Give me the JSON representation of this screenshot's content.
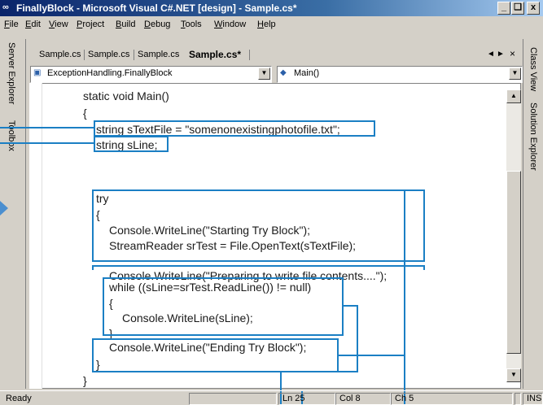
{
  "window": {
    "title": "FinallyBlock - Microsoft Visual C#.NET [design] - Sample.cs*",
    "icon": "vs-app-icon",
    "buttons": {
      "minimize": "_",
      "maximize": " ",
      "close": "x"
    }
  },
  "menu": [
    {
      "label": "File",
      "u": "F"
    },
    {
      "label": "Edit",
      "u": "E"
    },
    {
      "label": "View",
      "u": "V"
    },
    {
      "label": "Project",
      "u": "P"
    },
    {
      "label": "Build",
      "u": "B"
    },
    {
      "label": "Debug",
      "u": "D"
    },
    {
      "label": "Tools",
      "u": "T"
    },
    {
      "label": "Window",
      "u": "W"
    },
    {
      "label": "Help",
      "u": "H"
    }
  ],
  "left_panels": {
    "server_explorer": "Server Explorer",
    "toolbox": "Toolbox"
  },
  "right_panels": {
    "class_view": "Class View",
    "solution_explorer": "Solution Explorer"
  },
  "doc_tabs": {
    "items": [
      "Sample.cs",
      "Sample.cs",
      "Sample.cs",
      "Sample.cs*"
    ],
    "active_index": 3,
    "nav_left": "◄",
    "nav_right": "►",
    "close": "×"
  },
  "dropdowns": {
    "type": "ExceptionHandling.FinallyBlock",
    "member": "Main()"
  },
  "code": {
    "l1": "static void Main()",
    "l2": "{",
    "l3": "string sTextFile = \"somenonexistingphotofile.txt\";",
    "l4": "string sLine;",
    "l5": "try",
    "l6": "{",
    "l7": "Console.WriteLine(\"Starting Try Block\");",
    "l8": "StreamReader srTest = File.OpenText(sTextFile);",
    "l9": "Console.WriteLine(\"Preparing to write file contents....\");",
    "l10": "while ((sLine=srTest.ReadLine()) != null)",
    "l11": "{",
    "l12": "Console.WriteLine(sLine);",
    "l13": "}",
    "l14": "Console.WriteLine(\"Ending Try Block\");",
    "l15": "}",
    "l16": "}"
  },
  "status": {
    "ready": "Ready",
    "ln": "Ln 25",
    "col": "Col 8",
    "ch": "Ch 5",
    "ins": "INS"
  },
  "colors": {
    "highlight": "#1b7fc4",
    "titlebar_start": "#0a246a",
    "chrome": "#d4d0c8"
  }
}
